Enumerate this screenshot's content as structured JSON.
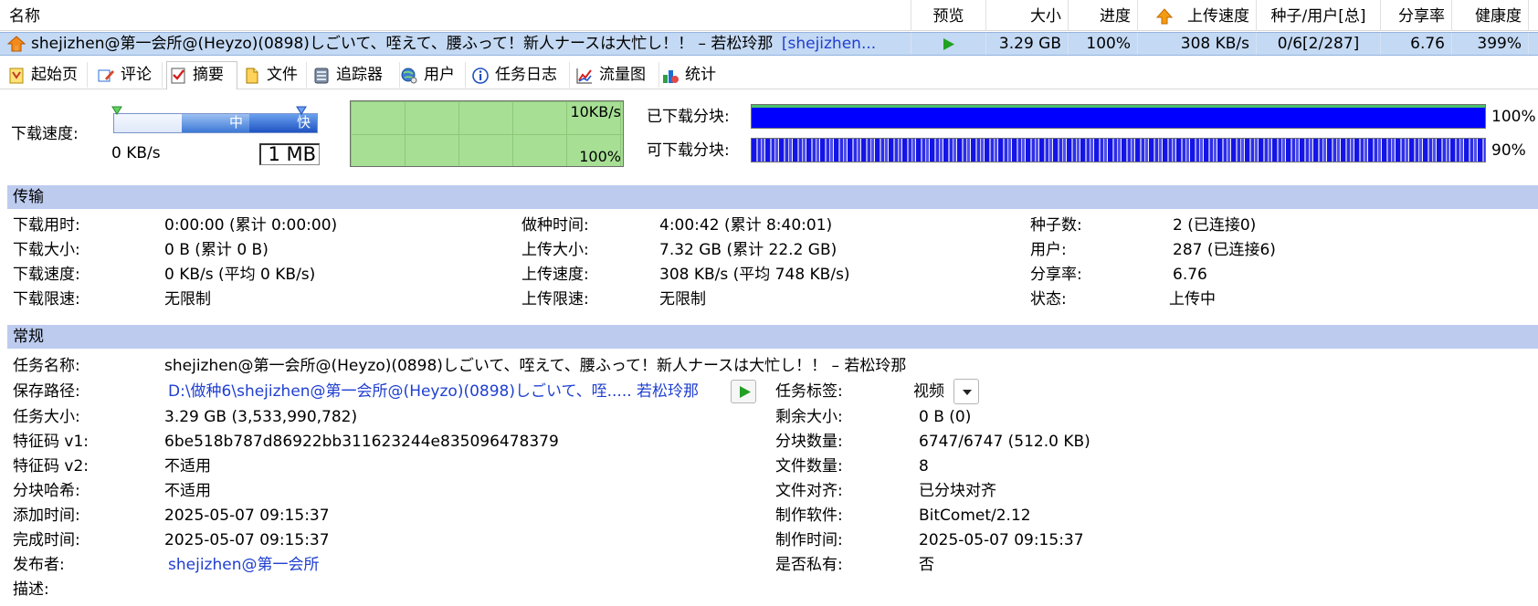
{
  "columns": {
    "name": "名称",
    "preview": "预览",
    "size": "大小",
    "progress": "进度",
    "upload_speed": "上传速度",
    "seeds_peers": "种子/用户[总]",
    "share_ratio": "分享率",
    "health": "健康度"
  },
  "task": {
    "name": "shejizhen@第一会所@(Heyzo)(0898)しごいて、咥えて、腰ふって！新人ナースは大忙し！！ – 若松玲那",
    "name_tag": "[shejizhen...",
    "size": "3.29 GB",
    "progress": "100%",
    "upload_speed": "308 KB/s",
    "seeds_peers": "0/6[2/287]",
    "share_ratio": "6.76",
    "health": "399%"
  },
  "tabs": [
    {
      "label": "起始页",
      "icon": "home-page-icon"
    },
    {
      "label": "评论",
      "icon": "comment-icon"
    },
    {
      "label": "摘要",
      "icon": "summary-icon"
    },
    {
      "label": "文件",
      "icon": "file-icon"
    },
    {
      "label": "追踪器",
      "icon": "tracker-icon"
    },
    {
      "label": "用户",
      "icon": "users-icon"
    },
    {
      "label": "任务日志",
      "icon": "info-icon"
    },
    {
      "label": "流量图",
      "icon": "traffic-chart-icon"
    },
    {
      "label": "统计",
      "icon": "statistics-icon"
    }
  ],
  "active_tab": "摘要",
  "speed": {
    "label": "下载速度:",
    "value": "0 KB/s",
    "limit": "1 MB",
    "mid": "中",
    "fast": "快",
    "graph_max": "10KB/s",
    "graph_pct": "100%"
  },
  "pieces": {
    "downloaded_label": "已下载分块:",
    "downloaded_pct": "100%",
    "downloaded_fraction": 1.0,
    "available_label": "可下载分块:",
    "available_pct": "90%",
    "available_fraction": 0.9,
    "bar_color": "#0000ff"
  },
  "transfer": {
    "title": "传输",
    "rows": [
      [
        [
          "下载用时:",
          "0:00:00 (累计 0:00:00)"
        ],
        [
          "做种时间:",
          "4:00:42 (累计 8:40:01)"
        ],
        [
          "种子数:",
          "2 (已连接0)"
        ]
      ],
      [
        [
          "下载大小:",
          "0 B (累计 0 B)"
        ],
        [
          "上传大小:",
          "7.32 GB (累计 22.2 GB)"
        ],
        [
          "用户:",
          "287 (已连接6)"
        ]
      ],
      [
        [
          "下载速度:",
          "0 KB/s (平均 0 KB/s)"
        ],
        [
          "上传速度:",
          "308 KB/s (平均 748 KB/s)"
        ],
        [
          "分享率:",
          "6.76"
        ]
      ],
      [
        [
          "下载限速:",
          "无限制"
        ],
        [
          "上传限速:",
          "无限制"
        ],
        [
          "状态:",
          "上传中"
        ]
      ]
    ]
  },
  "general": {
    "title": "常规",
    "task_name_label": "任务名称:",
    "task_name": "shejizhen@第一会所@(Heyzo)(0898)しごいて、咥えて、腰ふって！新人ナースは大忙し！！ – 若松玲那",
    "save_path_label": "保存路径:",
    "save_path": "D:\\做种6\\shejizhen@第一会所@(Heyzo)(0898)しごいて、咥..... 若松玲那",
    "task_tag_label": "任务标签:",
    "task_tag": "视频",
    "left": [
      [
        "任务大小:",
        "3.29 GB (3,533,990,782)"
      ],
      [
        "特征码 v1:",
        "6be518b787d86922bb311623244e835096478379"
      ],
      [
        "特征码 v2:",
        "不适用"
      ],
      [
        "分块哈希:",
        "不适用"
      ],
      [
        "添加时间:",
        "2025-05-07 09:15:37"
      ],
      [
        "完成时间:",
        "2025-05-07 09:15:37"
      ]
    ],
    "right": [
      [
        "剩余大小:",
        "0 B (0)"
      ],
      [
        "分块数量:",
        "6747/6747 (512.0 KB)"
      ],
      [
        "文件数量:",
        "8"
      ],
      [
        "文件对齐:",
        "已分块对齐"
      ],
      [
        "制作软件:",
        "BitComet/2.12"
      ],
      [
        "制作时间:",
        "2025-05-07 09:15:37"
      ]
    ],
    "publisher_label": "发布者:",
    "publisher": "shejizhen@第一会所",
    "private_label": "是否私有:",
    "private": "否",
    "description_label": "描述:"
  }
}
